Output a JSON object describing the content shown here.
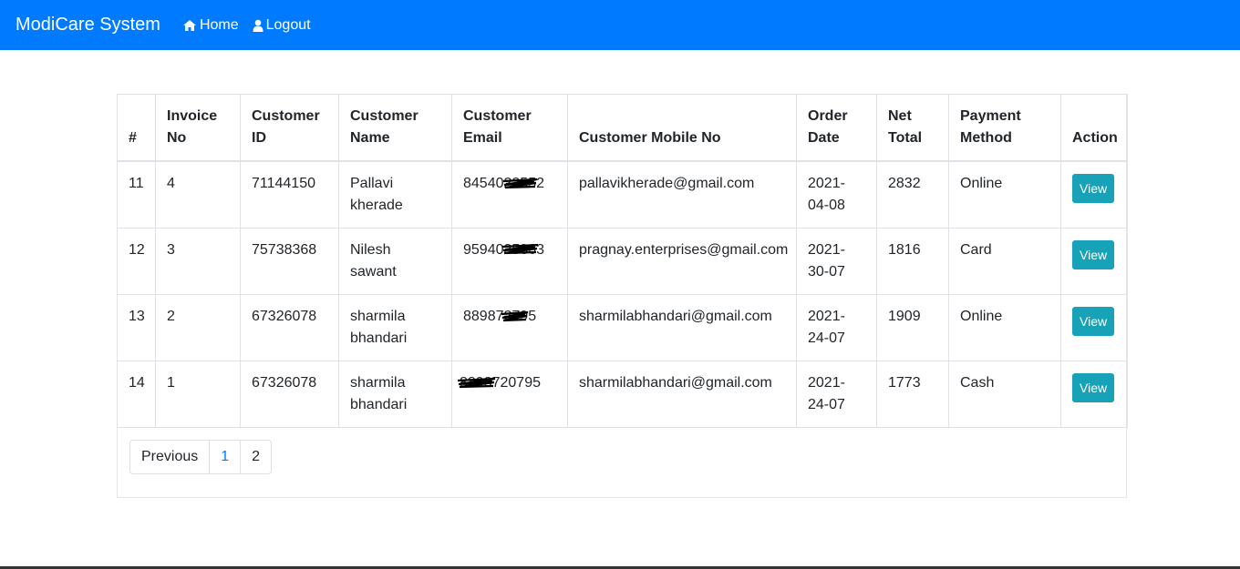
{
  "navbar": {
    "brand": "ModiCare System",
    "home_label": "Home",
    "logout_label": "Logout",
    "bg_color": "#007bff"
  },
  "table": {
    "headers": [
      "#",
      "Invoice No",
      "Customer ID",
      "Customer Name",
      "Customer Email",
      "Customer Mobile No",
      "Order Date",
      "Net Total",
      "Payment Method",
      "Action"
    ],
    "rows": [
      {
        "num": "11",
        "invoice": "4",
        "cust_id": "71144150",
        "name": "Pallavi kherade",
        "email_visible": "84540",
        "email_hidden": "22552",
        "mobile": "pallavikherade@gmail.com",
        "date": "2021-04-08",
        "total": "2832",
        "payment": "Online",
        "action": "View"
      },
      {
        "num": "12",
        "invoice": "3",
        "cust_id": "75738368",
        "name": "Nilesh sawant",
        "email_visible": "95940",
        "email_hidden": "35363",
        "mobile": "pragnay.enterprises@gmail.com",
        "date": "2021-30-07",
        "total": "1816",
        "payment": "Card",
        "action": "View"
      },
      {
        "num": "13",
        "invoice": "2",
        "cust_id": "67326078",
        "name": "sharmila bhandari",
        "email_visible": "88987",
        "email_hidden": "2795",
        "mobile": "sharmilabhandari@gmail.com",
        "date": "2021-24-07",
        "total": "1909",
        "payment": "Online",
        "action": "View"
      },
      {
        "num": "14",
        "invoice": "1",
        "cust_id": "67326078",
        "name": "sharmila bhandari",
        "email_visible": "720795",
        "email_hidden": "8898",
        "mobile": "sharmilabhandari@gmail.com",
        "date": "2021-24-07",
        "total": "1773",
        "payment": "Cash",
        "action": "View"
      }
    ]
  },
  "pagination": {
    "previous": "Previous",
    "pages": [
      "1",
      "2"
    ],
    "active_page": "1"
  },
  "colors": {
    "accent": "#007bff",
    "view_button": "#17a2b8"
  }
}
